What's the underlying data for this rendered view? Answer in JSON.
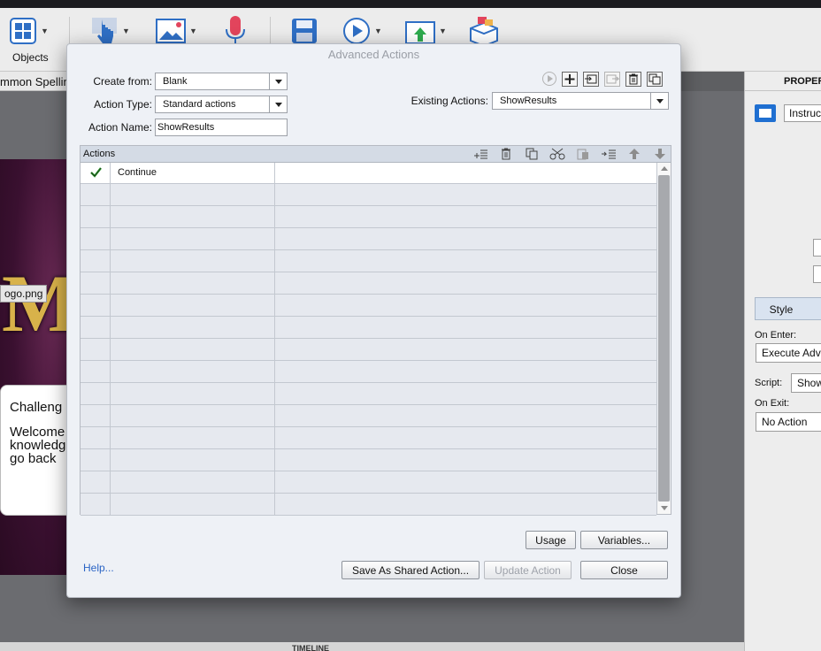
{
  "toolbar": {
    "objects_label": "Objects",
    "icons": [
      "objects-grid-icon",
      "interaction-hand-icon",
      "media-image-icon",
      "audio-mic-icon",
      "save-icon",
      "preview-play-icon",
      "publish-icon",
      "assets-box-icon"
    ]
  },
  "background": {
    "file_tab": "mmon Spellin",
    "slide_letter": "M",
    "logo_tooltip": "ogo.png",
    "card_title": "Challeng",
    "card_lines": [
      "Welcome",
      "knowledg",
      "go back"
    ],
    "timeline": "TIMELINE"
  },
  "properties": {
    "header": "PROPERT",
    "name_value": "Instruc",
    "style_tab": "Style",
    "on_enter_label": "On Enter:",
    "on_enter_value": "Execute Adva",
    "script_label": "Script:",
    "script_value": "Show",
    "on_exit_label": "On Exit:",
    "on_exit_value": "No Action"
  },
  "dialog": {
    "title": "Advanced Actions",
    "create_from_label": "Create from:",
    "create_from_value": "Blank",
    "action_type_label": "Action Type:",
    "action_type_value": "Standard actions",
    "action_name_label": "Action Name:",
    "action_name_value": "ShowResults",
    "existing_actions_label": "Existing Actions:",
    "existing_actions_value": "ShowResults",
    "grid_header": "Actions",
    "rows": [
      {
        "checked": true,
        "action": "Continue"
      },
      {
        "checked": false,
        "action": ""
      },
      {
        "checked": false,
        "action": ""
      },
      {
        "checked": false,
        "action": ""
      },
      {
        "checked": false,
        "action": ""
      },
      {
        "checked": false,
        "action": ""
      },
      {
        "checked": false,
        "action": ""
      },
      {
        "checked": false,
        "action": ""
      },
      {
        "checked": false,
        "action": ""
      },
      {
        "checked": false,
        "action": ""
      },
      {
        "checked": false,
        "action": ""
      },
      {
        "checked": false,
        "action": ""
      },
      {
        "checked": false,
        "action": ""
      },
      {
        "checked": false,
        "action": ""
      },
      {
        "checked": false,
        "action": ""
      },
      {
        "checked": false,
        "action": ""
      }
    ],
    "usage_button": "Usage",
    "variables_button": "Variables...",
    "help_link": "Help...",
    "save_shared_button": "Save As Shared Action...",
    "update_button": "Update Action",
    "close_button": "Close"
  }
}
